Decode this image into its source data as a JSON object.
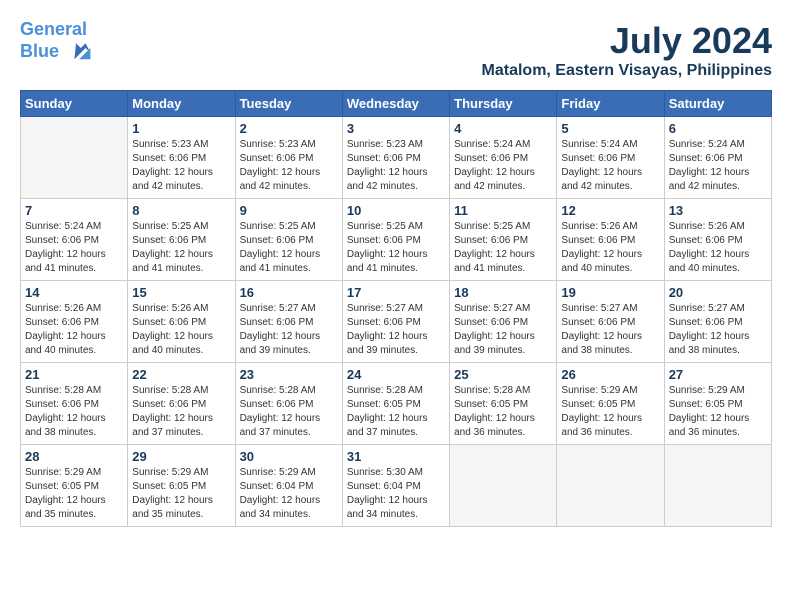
{
  "header": {
    "logo_line1": "General",
    "logo_line2": "Blue",
    "month_title": "July 2024",
    "location": "Matalom, Eastern Visayas, Philippines"
  },
  "calendar": {
    "days_of_week": [
      "Sunday",
      "Monday",
      "Tuesday",
      "Wednesday",
      "Thursday",
      "Friday",
      "Saturday"
    ],
    "weeks": [
      [
        {
          "day": "",
          "info": ""
        },
        {
          "day": "1",
          "info": "Sunrise: 5:23 AM\nSunset: 6:06 PM\nDaylight: 12 hours\nand 42 minutes."
        },
        {
          "day": "2",
          "info": "Sunrise: 5:23 AM\nSunset: 6:06 PM\nDaylight: 12 hours\nand 42 minutes."
        },
        {
          "day": "3",
          "info": "Sunrise: 5:23 AM\nSunset: 6:06 PM\nDaylight: 12 hours\nand 42 minutes."
        },
        {
          "day": "4",
          "info": "Sunrise: 5:24 AM\nSunset: 6:06 PM\nDaylight: 12 hours\nand 42 minutes."
        },
        {
          "day": "5",
          "info": "Sunrise: 5:24 AM\nSunset: 6:06 PM\nDaylight: 12 hours\nand 42 minutes."
        },
        {
          "day": "6",
          "info": "Sunrise: 5:24 AM\nSunset: 6:06 PM\nDaylight: 12 hours\nand 42 minutes."
        }
      ],
      [
        {
          "day": "7",
          "info": "Sunrise: 5:24 AM\nSunset: 6:06 PM\nDaylight: 12 hours\nand 41 minutes."
        },
        {
          "day": "8",
          "info": "Sunrise: 5:25 AM\nSunset: 6:06 PM\nDaylight: 12 hours\nand 41 minutes."
        },
        {
          "day": "9",
          "info": "Sunrise: 5:25 AM\nSunset: 6:06 PM\nDaylight: 12 hours\nand 41 minutes."
        },
        {
          "day": "10",
          "info": "Sunrise: 5:25 AM\nSunset: 6:06 PM\nDaylight: 12 hours\nand 41 minutes."
        },
        {
          "day": "11",
          "info": "Sunrise: 5:25 AM\nSunset: 6:06 PM\nDaylight: 12 hours\nand 41 minutes."
        },
        {
          "day": "12",
          "info": "Sunrise: 5:26 AM\nSunset: 6:06 PM\nDaylight: 12 hours\nand 40 minutes."
        },
        {
          "day": "13",
          "info": "Sunrise: 5:26 AM\nSunset: 6:06 PM\nDaylight: 12 hours\nand 40 minutes."
        }
      ],
      [
        {
          "day": "14",
          "info": "Sunrise: 5:26 AM\nSunset: 6:06 PM\nDaylight: 12 hours\nand 40 minutes."
        },
        {
          "day": "15",
          "info": "Sunrise: 5:26 AM\nSunset: 6:06 PM\nDaylight: 12 hours\nand 40 minutes."
        },
        {
          "day": "16",
          "info": "Sunrise: 5:27 AM\nSunset: 6:06 PM\nDaylight: 12 hours\nand 39 minutes."
        },
        {
          "day": "17",
          "info": "Sunrise: 5:27 AM\nSunset: 6:06 PM\nDaylight: 12 hours\nand 39 minutes."
        },
        {
          "day": "18",
          "info": "Sunrise: 5:27 AM\nSunset: 6:06 PM\nDaylight: 12 hours\nand 39 minutes."
        },
        {
          "day": "19",
          "info": "Sunrise: 5:27 AM\nSunset: 6:06 PM\nDaylight: 12 hours\nand 38 minutes."
        },
        {
          "day": "20",
          "info": "Sunrise: 5:27 AM\nSunset: 6:06 PM\nDaylight: 12 hours\nand 38 minutes."
        }
      ],
      [
        {
          "day": "21",
          "info": "Sunrise: 5:28 AM\nSunset: 6:06 PM\nDaylight: 12 hours\nand 38 minutes."
        },
        {
          "day": "22",
          "info": "Sunrise: 5:28 AM\nSunset: 6:06 PM\nDaylight: 12 hours\nand 37 minutes."
        },
        {
          "day": "23",
          "info": "Sunrise: 5:28 AM\nSunset: 6:06 PM\nDaylight: 12 hours\nand 37 minutes."
        },
        {
          "day": "24",
          "info": "Sunrise: 5:28 AM\nSunset: 6:05 PM\nDaylight: 12 hours\nand 37 minutes."
        },
        {
          "day": "25",
          "info": "Sunrise: 5:28 AM\nSunset: 6:05 PM\nDaylight: 12 hours\nand 36 minutes."
        },
        {
          "day": "26",
          "info": "Sunrise: 5:29 AM\nSunset: 6:05 PM\nDaylight: 12 hours\nand 36 minutes."
        },
        {
          "day": "27",
          "info": "Sunrise: 5:29 AM\nSunset: 6:05 PM\nDaylight: 12 hours\nand 36 minutes."
        }
      ],
      [
        {
          "day": "28",
          "info": "Sunrise: 5:29 AM\nSunset: 6:05 PM\nDaylight: 12 hours\nand 35 minutes."
        },
        {
          "day": "29",
          "info": "Sunrise: 5:29 AM\nSunset: 6:05 PM\nDaylight: 12 hours\nand 35 minutes."
        },
        {
          "day": "30",
          "info": "Sunrise: 5:29 AM\nSunset: 6:04 PM\nDaylight: 12 hours\nand 34 minutes."
        },
        {
          "day": "31",
          "info": "Sunrise: 5:30 AM\nSunset: 6:04 PM\nDaylight: 12 hours\nand 34 minutes."
        },
        {
          "day": "",
          "info": ""
        },
        {
          "day": "",
          "info": ""
        },
        {
          "day": "",
          "info": ""
        }
      ]
    ]
  }
}
